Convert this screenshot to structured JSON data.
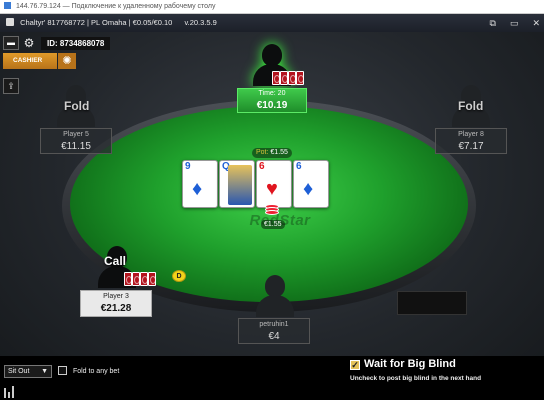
{
  "rdp": {
    "title": "144.76.79.124 — Подключение к удаленному рабочему столу"
  },
  "app": {
    "title": "Chaltyr' 817768772 | PL Omaha | €0.05/€0.10",
    "version": "v.20.3.5.9",
    "controls": [
      "⧉",
      "▭",
      "✕"
    ]
  },
  "toolbar": {
    "id_text": "ID: 8734868078",
    "cashier_label": "CASHIER"
  },
  "pot": {
    "label": "Pot:",
    "amount": "€1.55"
  },
  "bet": {
    "amount": "€1.55"
  },
  "board": [
    {
      "rank": "9",
      "suit": "♦",
      "color": "blue"
    },
    {
      "rank": "Q",
      "suit": "",
      "color": "blue",
      "face": true
    },
    {
      "rank": "6",
      "suit": "♥",
      "color": "red"
    },
    {
      "rank": "6",
      "suit": "♦",
      "color": "blue"
    }
  ],
  "logo_text": "RedStar",
  "dealer_label": "D",
  "seats": {
    "top": {
      "time": "Time: 20",
      "stack": "€10.19"
    },
    "player5": {
      "status": "Fold",
      "name": "Player 5",
      "stack": "€11.15"
    },
    "player8": {
      "status": "Fold",
      "name": "Player 8",
      "stack": "€7.17"
    },
    "player3": {
      "status": "Call",
      "name": "Player 3",
      "stack": "€21.28"
    },
    "hero": {
      "name": "petruhin1",
      "stack": "€4"
    }
  },
  "controls": {
    "sitout": "Sit Out",
    "fold_any": "Fold to any bet",
    "wait_title": "Wait for Big Blind",
    "wait_sub": "Uncheck to post big blind in the next hand",
    "wait_checked": true
  },
  "colors": {
    "felt": "#1fa02c",
    "active_glow": "#3cff3c",
    "cashier": "#e09a2a",
    "card_back": "#b3141e"
  }
}
